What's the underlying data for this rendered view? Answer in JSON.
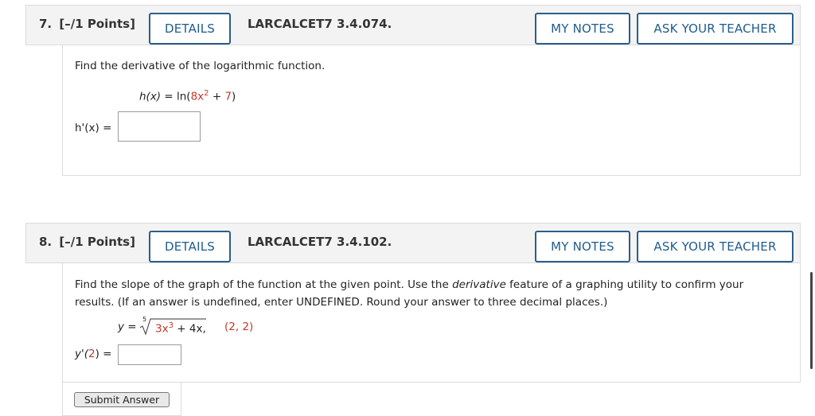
{
  "questions": [
    {
      "number": "7.",
      "points": "[–/1 Points]",
      "details_label": "DETAILS",
      "code": "LARCALCET7 3.4.074.",
      "my_notes_label": "MY NOTES",
      "ask_teacher_label": "ASK YOUR TEACHER",
      "prompt": "Find the derivative of the logarithmic function.",
      "function": {
        "lhs": "h(x)",
        "eq": " = ln(",
        "coef": "8x",
        "exp": "2",
        "plus": " + ",
        "const": "7",
        "close": ")"
      },
      "answer_label": "h'(x) =",
      "answer_value": ""
    },
    {
      "number": "8.",
      "points": "[–/1 Points]",
      "details_label": "DETAILS",
      "code": "LARCALCET7 3.4.102.",
      "my_notes_label": "MY NOTES",
      "ask_teacher_label": "ASK YOUR TEACHER",
      "prompt_line1_a": "Find the slope of the graph of the function at the given point. Use the ",
      "prompt_line1_em": "derivative",
      "prompt_line1_b": " feature of a graphing utility to confirm your",
      "prompt_line2": "results. (If an answer is undefined, enter UNDEFINED. Round your answer to three decimal places.)",
      "function": {
        "lhs": "y =",
        "root_index": "5",
        "term1": "3x",
        "exp": "3",
        "plus": " + 4x",
        "comma": ",",
        "point": "(2, 2)"
      },
      "answer_label_a": "y'(",
      "answer_label_arg": "2",
      "answer_label_b": ") =",
      "answer_value": "",
      "submit_label": "Submit Answer"
    }
  ],
  "colors": {
    "accent": "#1f5c8b",
    "highlight": "#c0392b"
  }
}
